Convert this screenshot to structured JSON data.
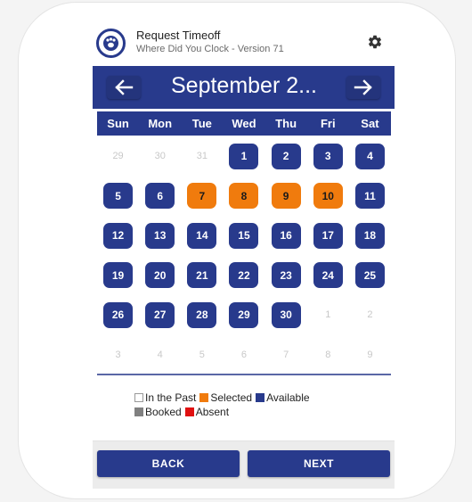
{
  "header": {
    "title": "Request Timeoff",
    "subtitle": "Where Did You Clock - Version 71",
    "logo_icon": "paw-icon",
    "settings_icon": "gear-icon"
  },
  "calendar": {
    "month_label": "September 2...",
    "prev_icon": "arrow-left-icon",
    "next_icon": "arrow-right-icon",
    "weekdays": [
      "Sun",
      "Mon",
      "Tue",
      "Wed",
      "Thu",
      "Fri",
      "Sat"
    ],
    "weeks": [
      [
        {
          "d": "29",
          "s": "out"
        },
        {
          "d": "30",
          "s": "out"
        },
        {
          "d": "31",
          "s": "out"
        },
        {
          "d": "1",
          "s": "available"
        },
        {
          "d": "2",
          "s": "available"
        },
        {
          "d": "3",
          "s": "available"
        },
        {
          "d": "4",
          "s": "available"
        }
      ],
      [
        {
          "d": "5",
          "s": "available"
        },
        {
          "d": "6",
          "s": "available"
        },
        {
          "d": "7",
          "s": "selected"
        },
        {
          "d": "8",
          "s": "selected"
        },
        {
          "d": "9",
          "s": "selected"
        },
        {
          "d": "10",
          "s": "selected"
        },
        {
          "d": "11",
          "s": "available"
        }
      ],
      [
        {
          "d": "12",
          "s": "available"
        },
        {
          "d": "13",
          "s": "available"
        },
        {
          "d": "14",
          "s": "available"
        },
        {
          "d": "15",
          "s": "available"
        },
        {
          "d": "16",
          "s": "available"
        },
        {
          "d": "17",
          "s": "available"
        },
        {
          "d": "18",
          "s": "available"
        }
      ],
      [
        {
          "d": "19",
          "s": "available"
        },
        {
          "d": "20",
          "s": "available"
        },
        {
          "d": "21",
          "s": "available"
        },
        {
          "d": "22",
          "s": "available"
        },
        {
          "d": "23",
          "s": "available"
        },
        {
          "d": "24",
          "s": "available"
        },
        {
          "d": "25",
          "s": "available"
        }
      ],
      [
        {
          "d": "26",
          "s": "available"
        },
        {
          "d": "27",
          "s": "available"
        },
        {
          "d": "28",
          "s": "available"
        },
        {
          "d": "29",
          "s": "available"
        },
        {
          "d": "30",
          "s": "available"
        },
        {
          "d": "1",
          "s": "out"
        },
        {
          "d": "2",
          "s": "out"
        }
      ],
      [
        {
          "d": "3",
          "s": "out"
        },
        {
          "d": "4",
          "s": "out"
        },
        {
          "d": "5",
          "s": "out"
        },
        {
          "d": "6",
          "s": "out"
        },
        {
          "d": "7",
          "s": "out"
        },
        {
          "d": "8",
          "s": "out"
        },
        {
          "d": "9",
          "s": "out"
        }
      ]
    ]
  },
  "legend": {
    "in_the_past": "In the Past",
    "selected": "Selected",
    "available": "Available",
    "booked": "Booked",
    "absent": "Absent"
  },
  "colors": {
    "primary": "#283a8c",
    "selected": "#f07b0d",
    "booked": "#808080",
    "absent": "#e01010"
  },
  "actions": {
    "back_label": "BACK",
    "next_label": "NEXT"
  }
}
